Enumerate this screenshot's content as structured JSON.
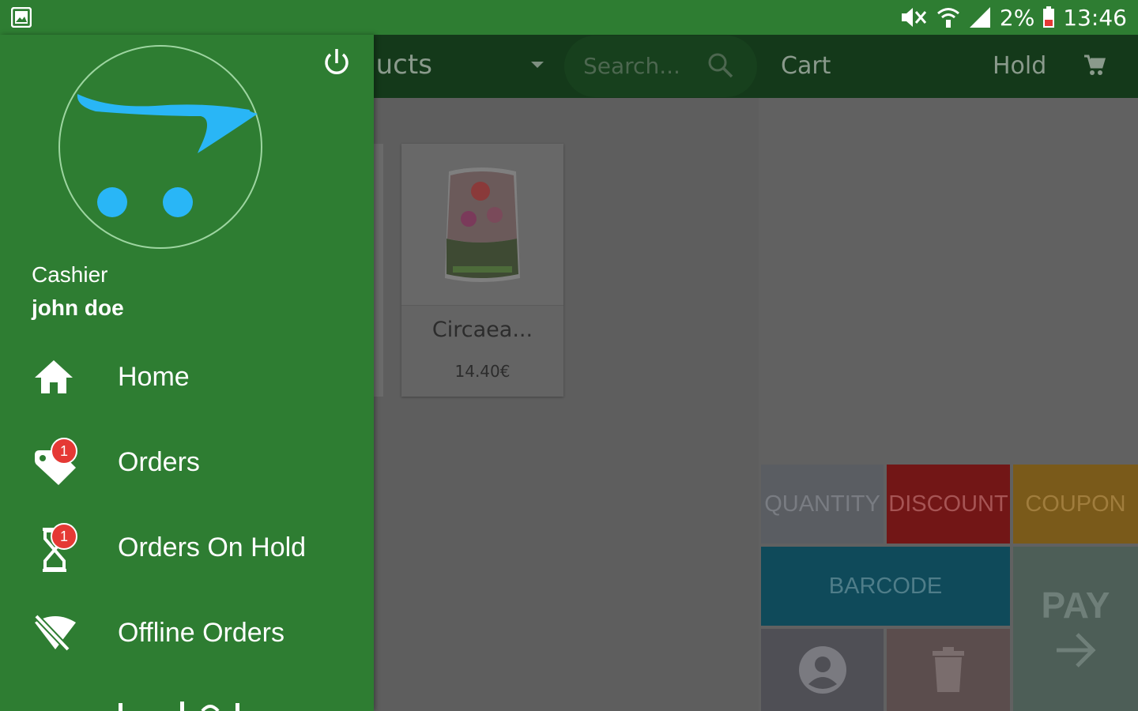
{
  "status_bar": {
    "battery": "2%",
    "time": "13:46"
  },
  "toolbar": {
    "title": "roducts",
    "search_placeholder": "Search...",
    "cart_label": "Cart",
    "hold_label": "Hold"
  },
  "products": [
    {
      "name": "Circaea...",
      "price": "14.40€"
    }
  ],
  "actions": {
    "quantity": "QUANTITY",
    "discount": "DISCOUNT",
    "coupon": "COUPON",
    "barcode": "BARCODE",
    "pay": "PAY"
  },
  "drawer": {
    "role": "Cashier",
    "user": "john doe",
    "items": [
      {
        "label": "Home",
        "icon": "home-icon"
      },
      {
        "label": "Orders",
        "icon": "orders-tag-icon",
        "badge": "1"
      },
      {
        "label": "Orders On Hold",
        "icon": "hourglass-icon",
        "badge": "1"
      },
      {
        "label": "Offline Orders",
        "icon": "wifi-off-icon"
      }
    ]
  },
  "colors": {
    "primary": "#2e7d32",
    "accent_logo": "#29b6f6",
    "badge": "#e53935",
    "discount": "#c62828",
    "coupon": "#f9a825",
    "barcode": "#1e8aa6"
  }
}
